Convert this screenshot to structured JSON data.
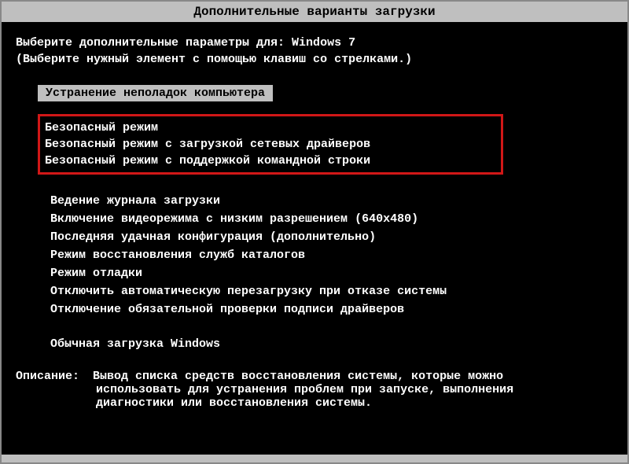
{
  "title": "Дополнительные варианты загрузки",
  "prompt1": "Выберите дополнительные параметры для: Windows 7",
  "prompt2": "(Выберите нужный элемент с помощью клавиш со стрелками.)",
  "selected_item": "Устранение неполадок компьютера",
  "safe_modes": [
    "Безопасный режим",
    "Безопасный режим с загрузкой сетевых драйверов",
    "Безопасный режим с поддержкой командной строки"
  ],
  "options": [
    "Ведение журнала загрузки",
    "Включение видеорежима с низким разрешением (640x480)",
    "Последняя удачная конфигурация (дополнительно)",
    "Режим восстановления служб каталогов",
    "Режим отладки",
    "Отключить автоматическую перезагрузку при отказе системы",
    "Отключение обязательной проверки подписи драйверов"
  ],
  "normal_boot": "Обычная загрузка Windows",
  "description_label": "Описание:",
  "description_line1": "Вывод списка средств восстановления системы, которые можно",
  "description_line2": "использовать для устранения проблем при запуске, выполнения",
  "description_line3": "диагностики или восстановления системы."
}
